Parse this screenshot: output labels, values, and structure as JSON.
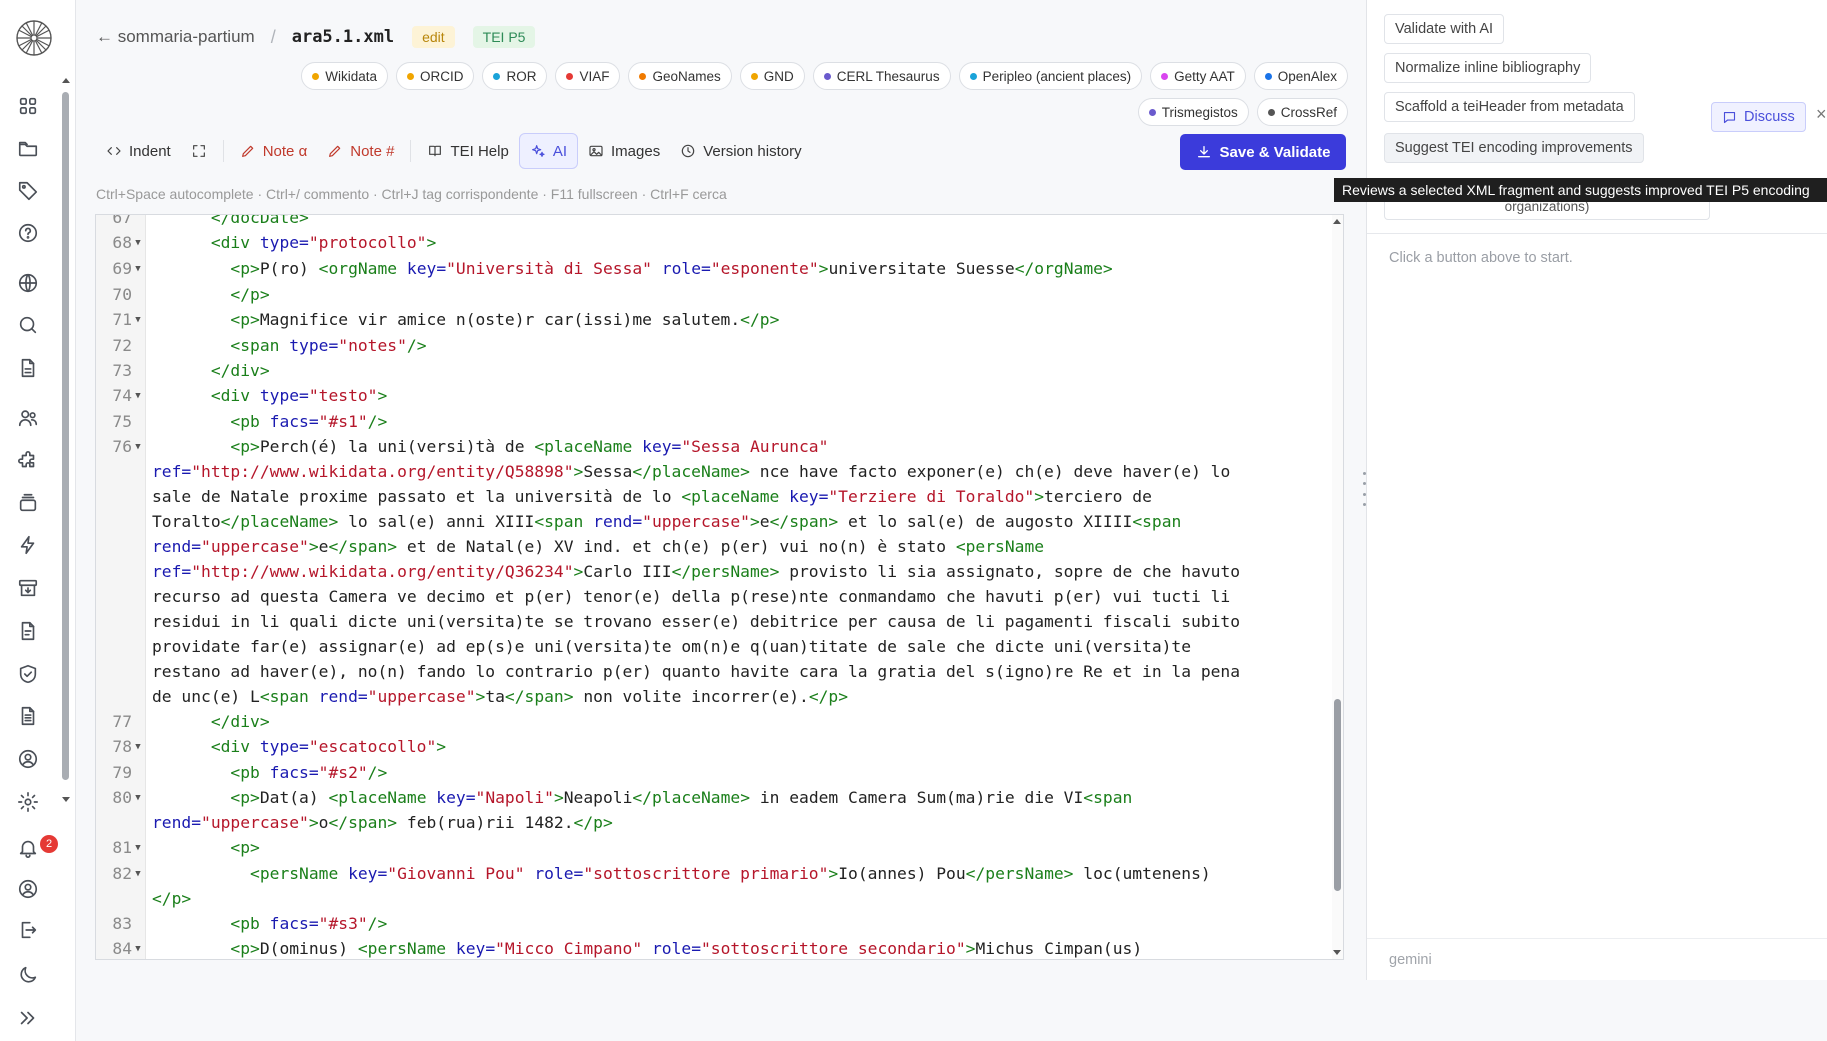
{
  "breadcrumb": {
    "back_label": "← sommaria-partium",
    "separator": "/",
    "file_name": "ara5.1.xml",
    "tag_edit": "edit",
    "tag_tei": "TEI P5"
  },
  "authorities": [
    {
      "label": "Wikidata",
      "color": "#f0a500"
    },
    {
      "label": "ORCID",
      "color": "#f0a500"
    },
    {
      "label": "ROR",
      "color": "#1aa3d9"
    },
    {
      "label": "VIAF",
      "color": "#e53935"
    },
    {
      "label": "GeoNames",
      "color": "#f07a00"
    },
    {
      "label": "GND",
      "color": "#f0a500"
    },
    {
      "label": "CERL Thesaurus",
      "color": "#6a5acd"
    },
    {
      "label": "Peripleo (ancient places)",
      "color": "#1aa3d9"
    },
    {
      "label": "Getty AAT",
      "color": "#d946ef"
    },
    {
      "label": "OpenAlex",
      "color": "#1a73e8"
    },
    {
      "label": "Trismegistos",
      "color": "#6a5acd"
    },
    {
      "label": "CrossRef",
      "color": "#555555"
    }
  ],
  "toolbar": {
    "indent": "Indent",
    "note_alpha": "Note α",
    "note_hash": "Note #",
    "tei_help": "TEI Help",
    "ai": "AI",
    "images": "Images",
    "version_history": "Version history",
    "save": "Save & Validate"
  },
  "shortcuts": "Ctrl+Space autocomplete · Ctrl+/ commento · Ctrl+J tag corrispondente · F11 fullscreen · Ctrl+F cerca",
  "notifications": {
    "count": "2"
  },
  "panel": {
    "buttons": [
      "Validate with AI",
      "Normalize inline bibliography",
      "Scaffold a teiHeader from metadata",
      "Suggest TEI encoding improvements"
    ],
    "partial_button": "organizations)",
    "discuss": "Discuss",
    "close": "×",
    "tooltip": "Reviews a selected XML fragment and suggests improved TEI P5 encoding",
    "hint": "Click a button above to start.",
    "model": "gemini"
  },
  "code": [
    {
      "n": "67",
      "fold": false,
      "tokens": [
        [
          "p",
          "      "
        ],
        [
          "t",
          "</docDate>"
        ]
      ]
    },
    {
      "n": "68",
      "fold": true,
      "tokens": [
        [
          "p",
          "      "
        ],
        [
          "t",
          "<div "
        ],
        [
          "a",
          "type="
        ],
        [
          "v",
          "\"protocollo\""
        ],
        [
          "t",
          ">"
        ]
      ]
    },
    {
      "n": "69",
      "fold": true,
      "tokens": [
        [
          "p",
          "        "
        ],
        [
          "t",
          "<p>"
        ],
        [
          "p",
          "P(ro) "
        ],
        [
          "t",
          "<orgName "
        ],
        [
          "a",
          "key="
        ],
        [
          "v",
          "\"Università di Sessa\""
        ],
        [
          "p",
          " "
        ],
        [
          "a",
          "role="
        ],
        [
          "v",
          "\"esponente\""
        ],
        [
          "t",
          ">"
        ],
        [
          "p",
          "universitate Suesse"
        ],
        [
          "t",
          "</orgName>"
        ]
      ]
    },
    {
      "n": "70",
      "fold": false,
      "tokens": [
        [
          "p",
          "        "
        ],
        [
          "t",
          "</p>"
        ]
      ]
    },
    {
      "n": "71",
      "fold": true,
      "tokens": [
        [
          "p",
          "        "
        ],
        [
          "t",
          "<p>"
        ],
        [
          "p",
          "Magnifice vir amice n(oste)r car(issi)me salutem."
        ],
        [
          "t",
          "</p>"
        ]
      ]
    },
    {
      "n": "72",
      "fold": false,
      "tokens": [
        [
          "p",
          "        "
        ],
        [
          "t",
          "<span "
        ],
        [
          "a",
          "type="
        ],
        [
          "v",
          "\"notes\""
        ],
        [
          "t",
          "/>"
        ]
      ]
    },
    {
      "n": "73",
      "fold": false,
      "tokens": [
        [
          "p",
          "      "
        ],
        [
          "t",
          "</div>"
        ]
      ]
    },
    {
      "n": "74",
      "fold": true,
      "tokens": [
        [
          "p",
          "      "
        ],
        [
          "t",
          "<div "
        ],
        [
          "a",
          "type="
        ],
        [
          "v",
          "\"testo\""
        ],
        [
          "t",
          ">"
        ]
      ]
    },
    {
      "n": "75",
      "fold": false,
      "tokens": [
        [
          "p",
          "        "
        ],
        [
          "t",
          "<pb "
        ],
        [
          "a",
          "facs="
        ],
        [
          "v",
          "\"#s1\""
        ],
        [
          "t",
          "/>"
        ]
      ]
    },
    {
      "n": "76",
      "fold": true,
      "tokens": [
        [
          "p",
          "        "
        ],
        [
          "t",
          "<p>"
        ],
        [
          "p",
          "Perch(é) la uni(versi)tà de "
        ],
        [
          "t",
          "<placeName "
        ],
        [
          "a",
          "key="
        ],
        [
          "v",
          "\"Sessa Aurunca\""
        ],
        [
          "p",
          "\n"
        ],
        [
          "a",
          "ref="
        ],
        [
          "v",
          "\"http://www.wikidata.org/entity/Q58898\""
        ],
        [
          "t",
          ">"
        ],
        [
          "p",
          "Sessa"
        ],
        [
          "t",
          "</placeName>"
        ],
        [
          "p",
          " nce have facto exponer(e) ch(e) deve haver(e) lo\nsale de Natale proxime passato et la università de lo "
        ],
        [
          "t",
          "<placeName "
        ],
        [
          "a",
          "key="
        ],
        [
          "v",
          "\"Terziere di Toraldo\""
        ],
        [
          "t",
          ">"
        ],
        [
          "p",
          "terciero de\nToralto"
        ],
        [
          "t",
          "</placeName>"
        ],
        [
          "p",
          " lo sal(e) anni XIII"
        ],
        [
          "t",
          "<span "
        ],
        [
          "a",
          "rend="
        ],
        [
          "v",
          "\"uppercase\""
        ],
        [
          "t",
          ">"
        ],
        [
          "p",
          "e"
        ],
        [
          "t",
          "</span>"
        ],
        [
          "p",
          " et lo sal(e) de augosto XIIII"
        ],
        [
          "t",
          "<span\n"
        ],
        [
          "a",
          "rend="
        ],
        [
          "v",
          "\"uppercase\""
        ],
        [
          "t",
          ">"
        ],
        [
          "p",
          "e"
        ],
        [
          "t",
          "</span>"
        ],
        [
          "p",
          " et de Natal(e) XV ind. et ch(e) p(er) vui no(n) è stato "
        ],
        [
          "t",
          "<persName\n"
        ],
        [
          "a",
          "ref="
        ],
        [
          "v",
          "\"http://www.wikidata.org/entity/Q36234\""
        ],
        [
          "t",
          ">"
        ],
        [
          "p",
          "Carlo III"
        ],
        [
          "t",
          "</persName>"
        ],
        [
          "p",
          " provisto li sia assignato, sopre de che havuto\nrecurso ad questa Camera ve decimo et p(er) tenor(e) della p(rese)nte conmandamo che havuti p(er) vui tucti li\nresidui in li quali dicte uni(versita)te se trovano esser(e) debitrice per causa de li pagamenti fiscali subito\nprovidate far(e) assignar(e) ad ep(s)e uni(versita)te om(n)e q(uan)titate de sale che dicte uni(versita)te\nrestano ad haver(e), no(n) fando lo contrario p(er) quanto havite cara la gratia del s(igno)re Re et in la pena\nde unc(e) L"
        ],
        [
          "t",
          "<span "
        ],
        [
          "a",
          "rend="
        ],
        [
          "v",
          "\"uppercase\""
        ],
        [
          "t",
          ">"
        ],
        [
          "p",
          "ta"
        ],
        [
          "t",
          "</span>"
        ],
        [
          "p",
          " non volite incorrer(e)."
        ],
        [
          "t",
          "</p>"
        ]
      ]
    },
    {
      "n": "77",
      "fold": false,
      "tokens": [
        [
          "p",
          "      "
        ],
        [
          "t",
          "</div>"
        ]
      ]
    },
    {
      "n": "78",
      "fold": true,
      "tokens": [
        [
          "p",
          "      "
        ],
        [
          "t",
          "<div "
        ],
        [
          "a",
          "type="
        ],
        [
          "v",
          "\"escatocollo\""
        ],
        [
          "t",
          ">"
        ]
      ]
    },
    {
      "n": "79",
      "fold": false,
      "tokens": [
        [
          "p",
          "        "
        ],
        [
          "t",
          "<pb "
        ],
        [
          "a",
          "facs="
        ],
        [
          "v",
          "\"#s2\""
        ],
        [
          "t",
          "/>"
        ]
      ]
    },
    {
      "n": "80",
      "fold": true,
      "tokens": [
        [
          "p",
          "        "
        ],
        [
          "t",
          "<p>"
        ],
        [
          "p",
          "Dat(a) "
        ],
        [
          "t",
          "<placeName "
        ],
        [
          "a",
          "key="
        ],
        [
          "v",
          "\"Napoli\""
        ],
        [
          "t",
          ">"
        ],
        [
          "p",
          "Neapoli"
        ],
        [
          "t",
          "</placeName>"
        ],
        [
          "p",
          " in eadem Camera Sum(ma)rie die VI"
        ],
        [
          "t",
          "<span\n"
        ],
        [
          "a",
          "rend="
        ],
        [
          "v",
          "\"uppercase\""
        ],
        [
          "t",
          ">"
        ],
        [
          "p",
          "o"
        ],
        [
          "t",
          "</span>"
        ],
        [
          "p",
          " feb(rua)rii 1482."
        ],
        [
          "t",
          "</p>"
        ]
      ]
    },
    {
      "n": "81",
      "fold": true,
      "tokens": [
        [
          "p",
          "        "
        ],
        [
          "t",
          "<p>"
        ]
      ]
    },
    {
      "n": "82",
      "fold": true,
      "tokens": [
        [
          "p",
          "          "
        ],
        [
          "t",
          "<persName "
        ],
        [
          "a",
          "key="
        ],
        [
          "v",
          "\"Giovanni Pou\""
        ],
        [
          "p",
          " "
        ],
        [
          "a",
          "role="
        ],
        [
          "v",
          "\"sottoscrittore primario\""
        ],
        [
          "t",
          ">"
        ],
        [
          "p",
          "Io(annes) Pou"
        ],
        [
          "t",
          "</persName>"
        ],
        [
          "p",
          " loc(umtenens)\n"
        ],
        [
          "t",
          "</p>"
        ]
      ]
    },
    {
      "n": "83",
      "fold": false,
      "tokens": [
        [
          "p",
          "        "
        ],
        [
          "t",
          "<pb "
        ],
        [
          "a",
          "facs="
        ],
        [
          "v",
          "\"#s3\""
        ],
        [
          "t",
          "/>"
        ]
      ]
    },
    {
      "n": "84",
      "fold": true,
      "tokens": [
        [
          "p",
          "        "
        ],
        [
          "t",
          "<p>"
        ],
        [
          "p",
          "D(ominus) "
        ],
        [
          "t",
          "<persName "
        ],
        [
          "a",
          "key="
        ],
        [
          "v",
          "\"Micco Cimpano\""
        ],
        [
          "p",
          " "
        ],
        [
          "a",
          "role="
        ],
        [
          "v",
          "\"sottoscrittore secondario\""
        ],
        [
          "t",
          ">"
        ],
        [
          "p",
          "Michus Cimpan(us)"
        ]
      ]
    }
  ]
}
